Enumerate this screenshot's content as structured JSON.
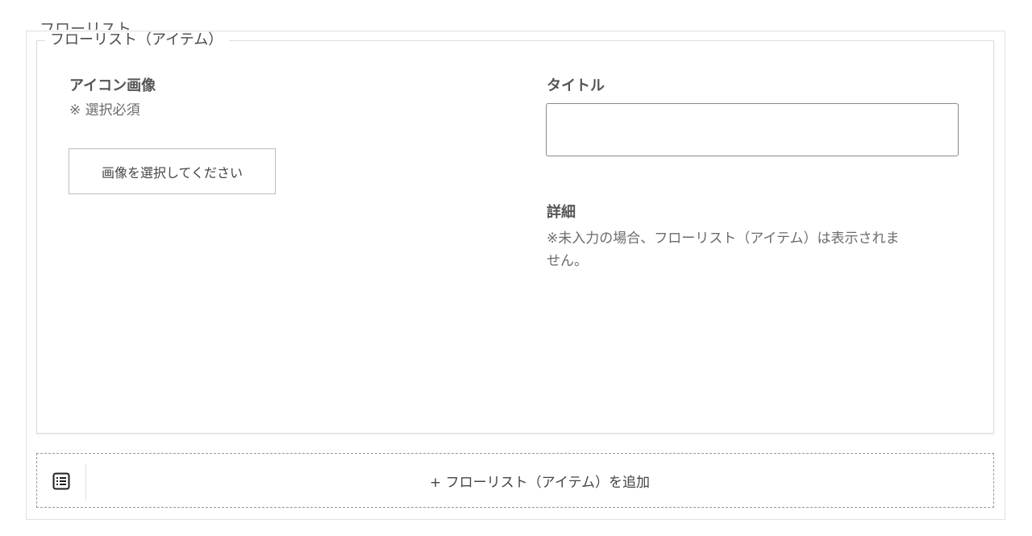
{
  "outer_block": {
    "legend": "フローリスト"
  },
  "item": {
    "legend": "フローリスト（アイテム）",
    "icon_field": {
      "label": "アイコン画像",
      "note": "※ 選択必須",
      "button_label": "画像を選択してください"
    },
    "title_field": {
      "label": "タイトル",
      "value": "",
      "placeholder": ""
    },
    "detail_field": {
      "label": "詳細",
      "note_line1": "※未入力の場合、フローリスト（アイテム）は表示されま",
      "note_line2": "せん。"
    }
  },
  "appender": {
    "icon": "list-view-icon",
    "label": "+ フローリスト（アイテム）を追加"
  }
}
